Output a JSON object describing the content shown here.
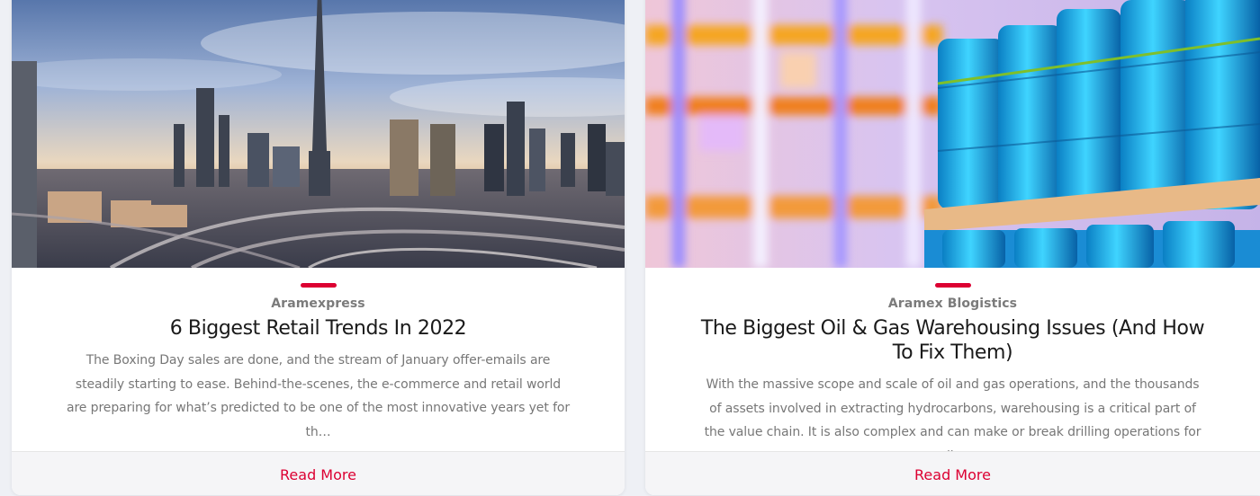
{
  "cards": [
    {
      "image_alt": "Dubai skyline with highway interchanges at sunset",
      "category": "Aramexpress",
      "title": "6 Biggest Retail Trends In 2022",
      "excerpt": "The Boxing Day sales are done, and the stream of January offer-emails are steadily starting to ease. Behind-the-scenes, the e-commerce and retail world are preparing for what’s predicted to be one of the most innovative years yet for th…",
      "read_more": "Read More"
    },
    {
      "image_alt": "Blue oil barrels on wooden pallets in a warehouse",
      "category": "Aramex Blogistics",
      "title": "The Biggest Oil & Gas Warehousing Issues (And How To Fix Them)",
      "excerpt": "With the massive scope and scale of oil and gas operations, and the thousands of assets involved in extracting hydrocarbons, warehousing is a critical part of the value chain. It is also complex and can make or break drilling operations for oil…",
      "read_more": "Read More"
    }
  ],
  "colors": {
    "accent": "#dc0032",
    "page_bg": "#eef0f5",
    "card_bg": "#ffffff",
    "footer_bg": "#f5f5f7"
  }
}
